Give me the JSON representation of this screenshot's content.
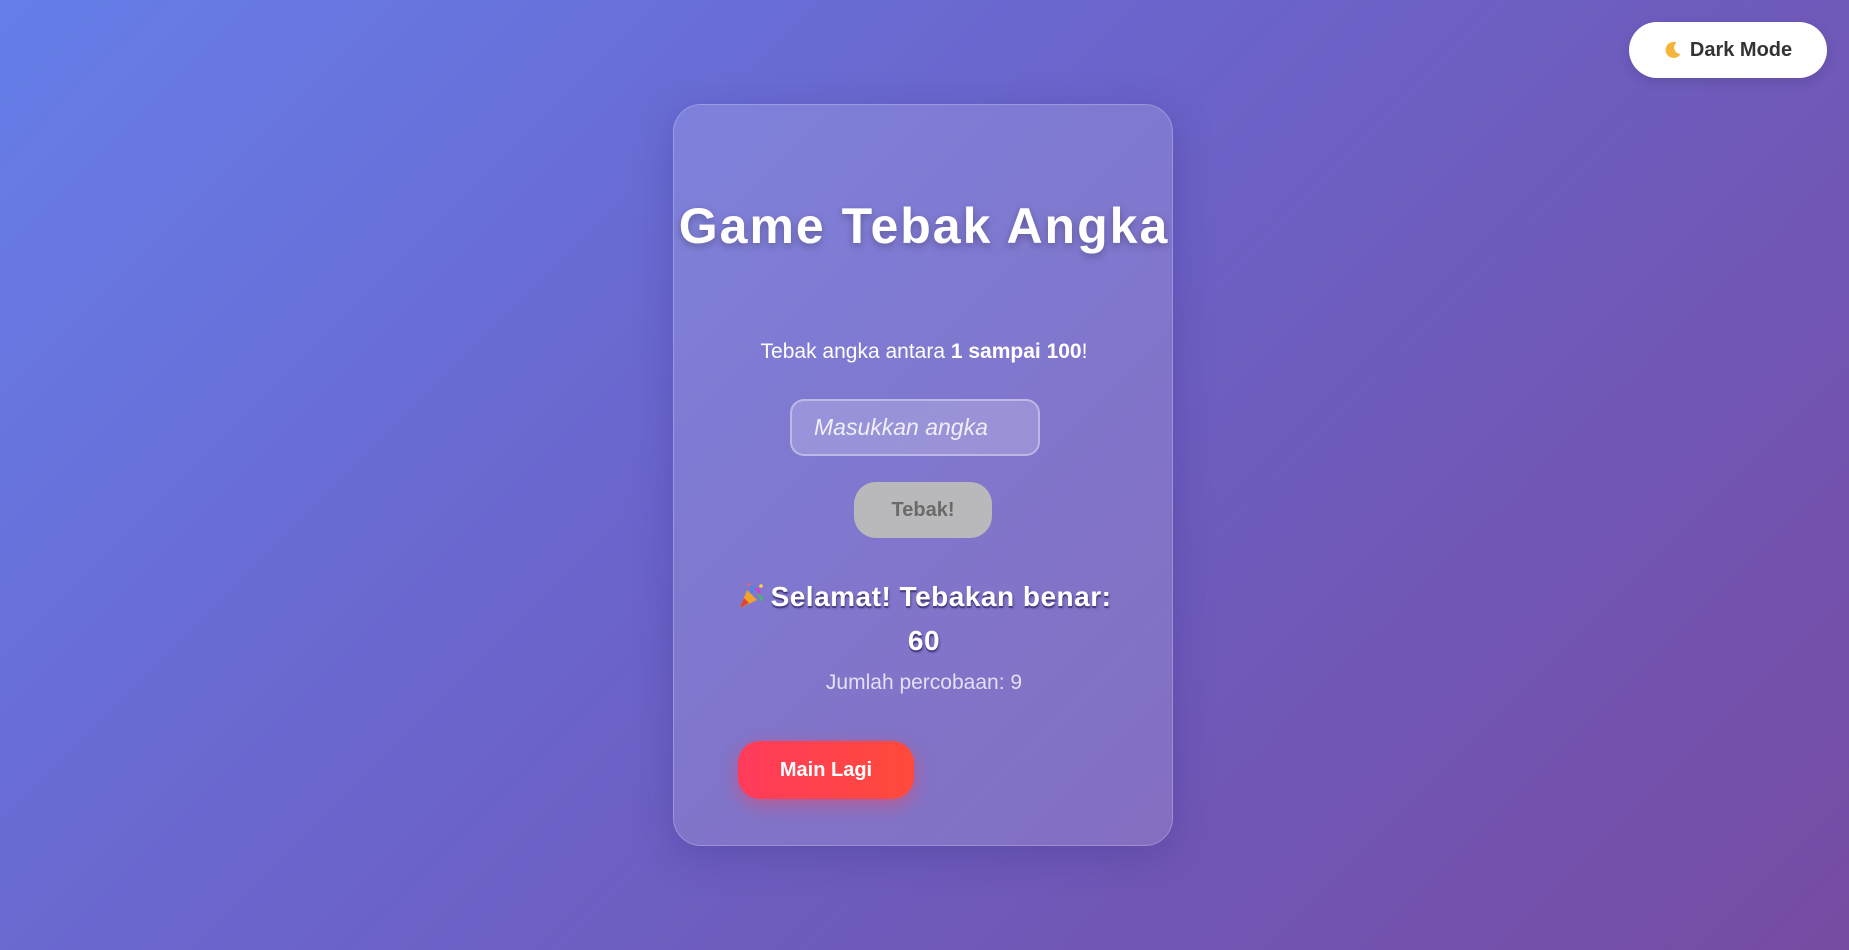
{
  "theme_toggle": {
    "icon": "moon-icon",
    "label": "Dark Mode"
  },
  "game": {
    "title": "Game Tebak Angka",
    "subtitle_prefix": "Tebak angka antara ",
    "subtitle_range": "1 sampai 100",
    "subtitle_suffix": "!",
    "input_placeholder": "Masukkan angka",
    "input_value": "",
    "guess_button": "Tebak!",
    "result_icon": "party-popper-icon",
    "result_text": "Selamat! Tebakan benar: 60",
    "attempts_label": "Jumlah percobaan: ",
    "attempts_value": "9",
    "play_again_button": "Main Lagi"
  },
  "colors": {
    "background_start": "#667eea",
    "background_end": "#764ba2",
    "play_again": "#ff4a3a",
    "disabled_button": "#b9b9bb"
  }
}
